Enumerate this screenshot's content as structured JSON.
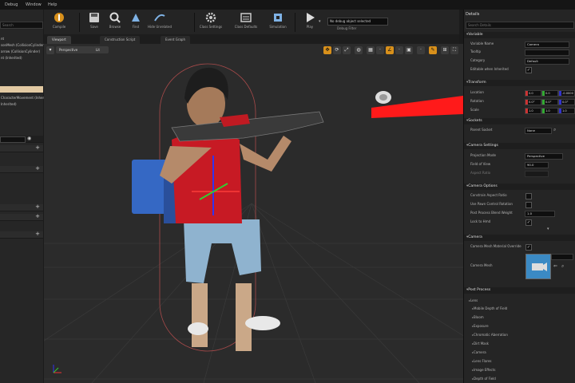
{
  "menu": {
    "items": [
      "Debug",
      "Window",
      "Help"
    ]
  },
  "toolbar": {
    "buttons": [
      "Compile",
      "Save",
      "Browse",
      "Find",
      "Hide Unrelated",
      "Class Settings",
      "Class Defaults",
      "Simulation",
      "Play"
    ],
    "debug_filter_value": "No debug object selected",
    "debug_filter_label": "Debug Filter"
  },
  "left_panel": {
    "search_placeholder": "Search",
    "text_lines": [
      "nt",
      "sonMesh (CollisionCylinder)",
      "arrow (CollisionCylinder)",
      "nt (Inherited)",
      "Inherited)"
    ],
    "highlight_text": "CharacterMovement (Inherited)"
  },
  "tabs": [
    "Viewport",
    "Construction Script",
    "Event Graph"
  ],
  "viewport": {
    "view_mode": "Perspective",
    "lit_mode": "Lit",
    "toolbar_icons": [
      "move-icon",
      "rotate-icon",
      "scale-icon",
      "world-icon",
      "snap-icon",
      "grid-value",
      "angle-icon",
      "angle-value",
      "scale-snap-icon",
      "scale-value",
      "camera-speed-icon",
      "maximize-icon"
    ]
  },
  "details": {
    "title": "Details",
    "search_placeholder": "Search Details",
    "sections": {
      "variable": {
        "label": "Variable",
        "rows": [
          {
            "name": "Variable Name",
            "value": "Camera"
          },
          {
            "name": "Tooltip",
            "value": ""
          },
          {
            "name": "Category",
            "value": "Default"
          },
          {
            "name": "Editable when Inherited",
            "value": "✓"
          }
        ]
      },
      "transform": {
        "label": "Transform",
        "location": {
          "name": "Location",
          "values": [
            "0.0",
            "0.0",
            "-0.0000"
          ]
        },
        "rotation": {
          "name": "Rotation",
          "values": [
            "0.0°",
            "0.0°",
            "0.0°"
          ]
        },
        "scale": {
          "name": "Scale",
          "values": [
            "1.0",
            "1.0",
            "1.0"
          ]
        }
      },
      "sockets": {
        "label": "Sockets",
        "parent_socket_label": "Parent Socket",
        "parent_socket_value": "None"
      },
      "camera_settings": {
        "label": "Camera Settings",
        "rows": [
          {
            "name": "Projection Mode",
            "value": "Perspective"
          },
          {
            "name": "Field of View",
            "value": "90.0"
          },
          {
            "name": "Aspect Ratio",
            "value": ""
          }
        ]
      },
      "camera_options": {
        "label": "Camera Options",
        "rows": [
          {
            "name": "Constrain Aspect Ratio",
            "value": ""
          },
          {
            "name": "Use Pawn Control Rotation",
            "value": ""
          },
          {
            "name": "Post Process Blend Weight",
            "value": "1.0"
          },
          {
            "name": "Lock to Hmd",
            "value": "✓"
          }
        ]
      },
      "camera": {
        "label": "Camera",
        "rows": [
          {
            "name": "Camera Mesh Material Override",
            "value": "✓"
          },
          {
            "name": "Camera Mesh",
            "value": ""
          }
        ]
      },
      "post_process": {
        "label": "Post Process",
        "items": [
          "Lens",
          "Mobile Depth of Field",
          "Bloom",
          "Exposure",
          "Chromatic Aberration",
          "Dirt Mask",
          "Camera",
          "Lens Flares",
          "Image Effects",
          "Depth of Field"
        ]
      }
    }
  },
  "colors": {
    "accent": "#d8901b",
    "panel": "#252525",
    "viewport_bg": "#2b2b2b",
    "laser": "#ff1a1a"
  }
}
